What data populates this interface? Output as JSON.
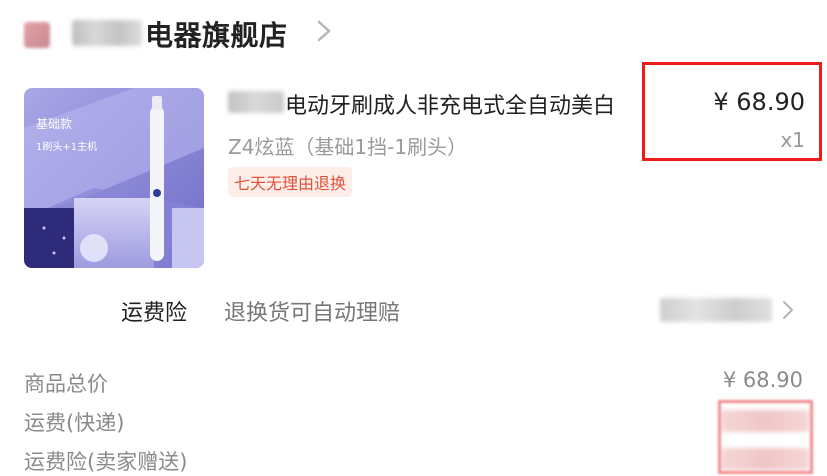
{
  "store": {
    "name": "电器旗舰店",
    "chevron_icon": "chevron-right-icon"
  },
  "product": {
    "title": "电动牙刷成人非充电式全自动美白",
    "spec": "Z4炫蓝（基础1挡-1刷头）",
    "tag": "七天无理由退换",
    "price": "¥ 68.90",
    "qty": "x1",
    "image_text_line1": "基础款",
    "image_text_line2": "1刷头+1主机"
  },
  "insurance": {
    "label": "运费险",
    "description": "退换货可自动理赔",
    "chevron_icon": "chevron-right-icon"
  },
  "summary": [
    {
      "label": "商品总价",
      "value": "¥ 68.90"
    },
    {
      "label": "运费(快递)",
      "value": ""
    },
    {
      "label": "运费险(卖家赠送)",
      "value": ""
    }
  ],
  "colors": {
    "highlight_box": "#ec1c1c",
    "tag_text": "#e0533a",
    "tag_bg": "#fdeee9"
  }
}
